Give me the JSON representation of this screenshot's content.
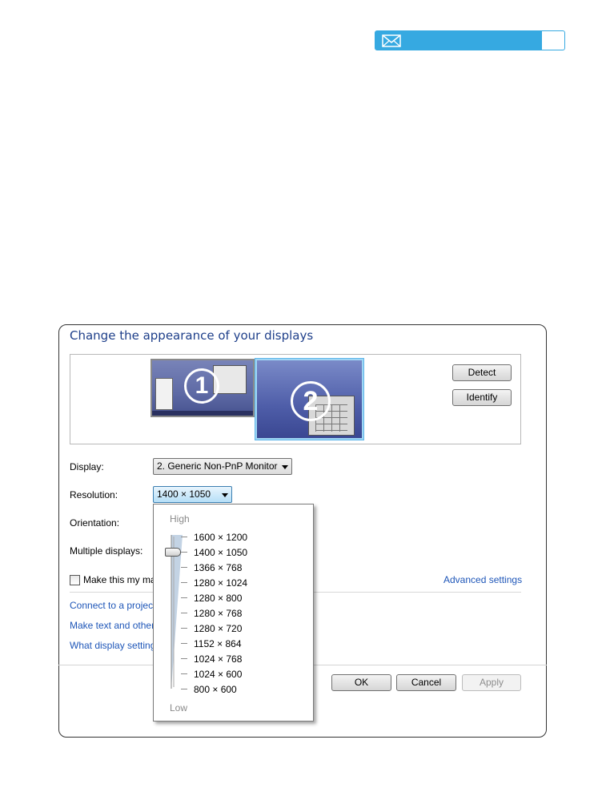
{
  "header": {
    "mail_icon": "envelope-icon",
    "accent": "#36a9e1"
  },
  "dialog": {
    "title": "Change the appearance of your displays",
    "monitors": [
      "1",
      "2"
    ],
    "detect_label": "Detect",
    "identify_label": "Identify",
    "display_label": "Display:",
    "display_value": "2. Generic Non-PnP Monitor",
    "resolution_label": "Resolution:",
    "resolution_value": "1400 × 1050",
    "orientation_label": "Orientation:",
    "multiple_displays_label": "Multiple displays:",
    "make_main_label": "Make this my ma",
    "advanced_settings": "Advanced settings",
    "links": [
      "Connect to a projec",
      "Make text and other",
      "What display setting"
    ],
    "ok_label": "OK",
    "cancel_label": "Cancel",
    "apply_label": "Apply"
  },
  "resolution_dropdown": {
    "high_label": "High",
    "low_label": "Low",
    "options": [
      "1600 × 1200",
      "1400 × 1050",
      "1366 × 768",
      "1280 × 1024",
      "1280 × 800",
      "1280 × 768",
      "1280 × 720",
      "1152 × 864",
      "1024 × 768",
      "1024 × 600",
      "800 × 600"
    ],
    "selected": "1400 × 1050"
  }
}
